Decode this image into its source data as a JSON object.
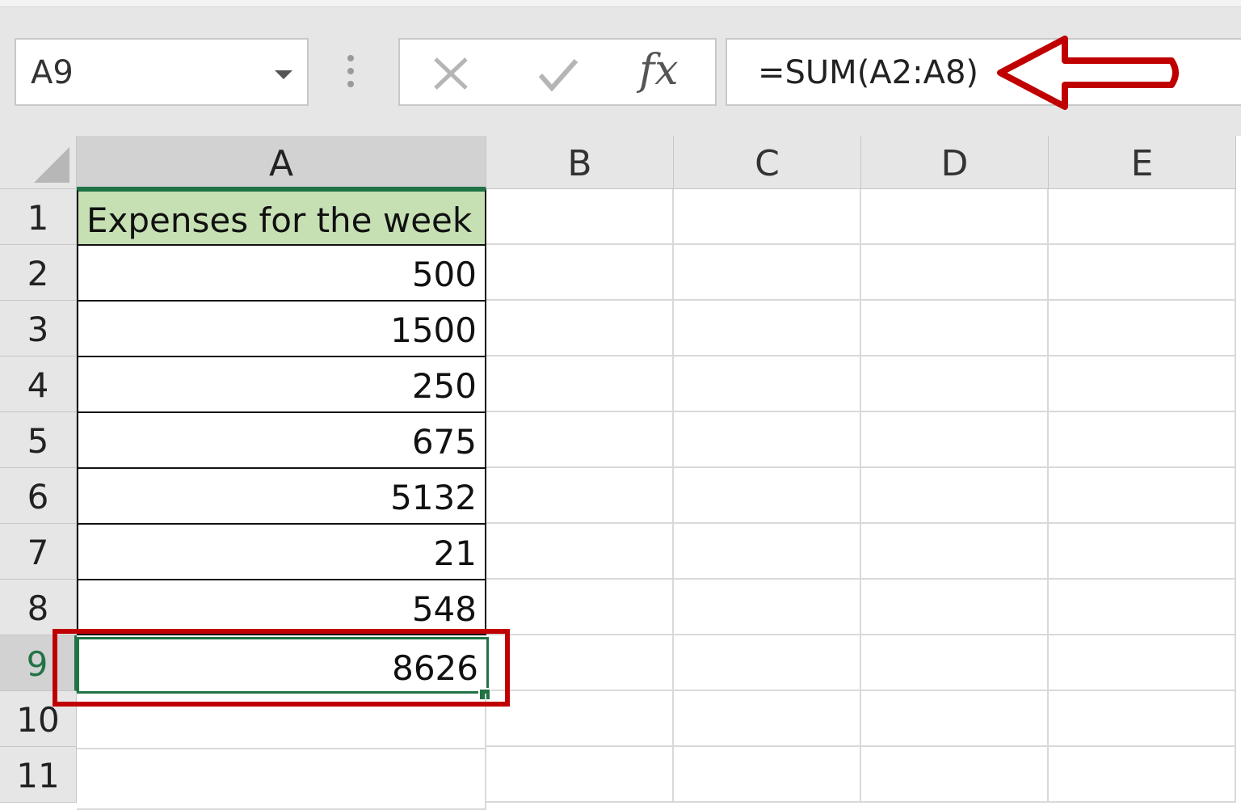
{
  "name_box": {
    "value": "A9"
  },
  "formula_bar": {
    "formula": "=SUM(A2:A8)",
    "fx_label": "fx"
  },
  "sheet": {
    "columns": [
      "A",
      "B",
      "C",
      "D",
      "E"
    ],
    "rows": [
      "1",
      "2",
      "3",
      "4",
      "5",
      "6",
      "7",
      "8",
      "9",
      "10",
      "11"
    ],
    "active_cell": "A9",
    "cells": {
      "A1": "Expenses for the week",
      "A2": "500",
      "A3": "1500",
      "A4": "250",
      "A5": "675",
      "A6": "5132",
      "A7": "21",
      "A8": "548",
      "A9": "8626"
    }
  },
  "colors": {
    "excel_green": "#217346",
    "header_fill": "#c6e0b4",
    "annotation_red": "#c00000"
  }
}
